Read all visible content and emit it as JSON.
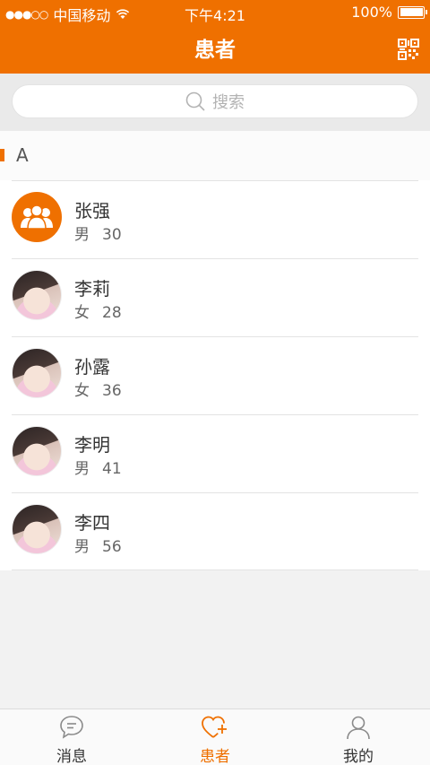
{
  "status_bar": {
    "carrier": "中国移动",
    "time": "下午4:21",
    "battery": "100%"
  },
  "nav": {
    "title": "患者"
  },
  "search": {
    "placeholder": "搜索"
  },
  "section": {
    "letter": "A"
  },
  "patients": [
    {
      "name": "张强",
      "gender": "男",
      "age": "30",
      "avatar": "default-group-avatar"
    },
    {
      "name": "李莉",
      "gender": "女",
      "age": "28",
      "avatar": "photo"
    },
    {
      "name": "孙露",
      "gender": "女",
      "age": "36",
      "avatar": "photo"
    },
    {
      "name": "李明",
      "gender": "男",
      "age": "41",
      "avatar": "photo"
    },
    {
      "name": "李四",
      "gender": "男",
      "age": "56",
      "avatar": "photo"
    }
  ],
  "tabs": [
    {
      "label": "消息",
      "icon": "chat-bubble-icon",
      "active": false
    },
    {
      "label": "患者",
      "icon": "heart-plus-icon",
      "active": true
    },
    {
      "label": "我的",
      "icon": "person-icon",
      "active": false
    }
  ],
  "colors": {
    "accent": "#ef7000"
  }
}
